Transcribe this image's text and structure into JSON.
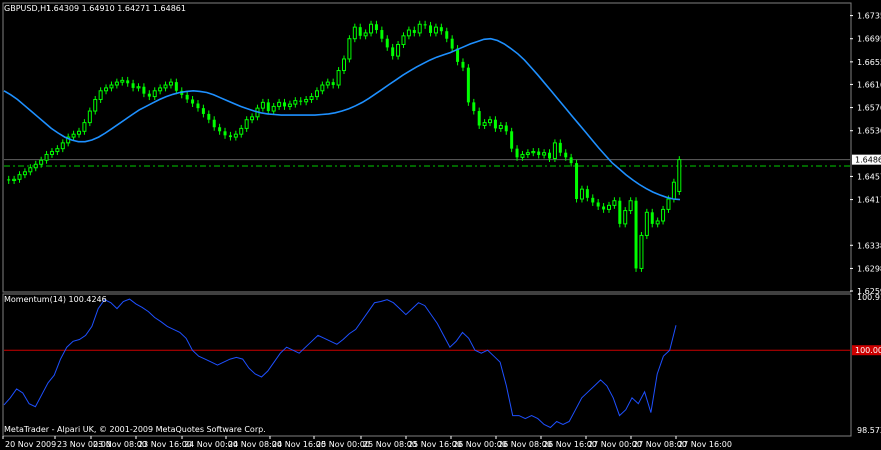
{
  "header": {
    "symbol": "GBPUSD,H1",
    "ohlc": "1.64309 1.64910 1.64271 1.64861"
  },
  "footer": {
    "copyright": "MetaTrader - Alpari UK, © 2001-2009 MetaQuotes Software Corp."
  },
  "colors": {
    "background": "#000000",
    "candle": "#00ff00",
    "ma_line": "#1e90ff",
    "level_line": "#00cc00",
    "momentum_line": "#1e50ff",
    "momentum_base": "#cc0000",
    "axis": "#ffffff",
    "base_badge": "#cc0000"
  },
  "chart_data": [
    {
      "type": "candlestick",
      "title": "GBPUSD,H1",
      "ylim": [
        1.6259,
        1.6755
      ],
      "y_ticks": [
        "1.67350",
        "1.66950",
        "1.66550",
        "1.66160",
        "1.65760",
        "1.65360",
        "1.64570",
        "1.64170",
        "1.63380",
        "1.62980",
        "1.62590"
      ],
      "last_price_label": "1.64861",
      "horizontal_level": 1.6475,
      "series": [
        {
          "name": "close",
          "values": [
            1.645,
            1.6452,
            1.646,
            1.6465,
            1.6472,
            1.6478,
            1.6485,
            1.6495,
            1.65,
            1.6505,
            1.6515,
            1.6525,
            1.653,
            1.6535,
            1.655,
            1.657,
            1.659,
            1.6605,
            1.661,
            1.6615,
            1.662,
            1.6623,
            1.6618,
            1.661,
            1.6612,
            1.66,
            1.6595,
            1.6605,
            1.661,
            1.6615,
            1.662,
            1.6605,
            1.6598,
            1.659,
            1.6583,
            1.6575,
            1.6565,
            1.6555,
            1.6542,
            1.6535,
            1.6528,
            1.6525,
            1.653,
            1.654,
            1.6555,
            1.656,
            1.6575,
            1.6585,
            1.657,
            1.6578,
            1.6585,
            1.6578,
            1.6582,
            1.6588,
            1.6586,
            1.659,
            1.6595,
            1.6605,
            1.6615,
            1.662,
            1.6615,
            1.664,
            1.666,
            1.6695,
            1.6715,
            1.67,
            1.6705,
            1.672,
            1.671,
            1.6695,
            1.668,
            1.6665,
            1.6685,
            1.67,
            1.671,
            1.6705,
            1.672,
            1.6718,
            1.6705,
            1.6715,
            1.6708,
            1.6695,
            1.6678,
            1.6655,
            1.6645,
            1.6585,
            1.657,
            1.6545,
            1.655,
            1.6555,
            1.654,
            1.6545,
            1.6535,
            1.6505,
            1.649,
            1.6495,
            1.6498,
            1.65,
            1.6494,
            1.6498,
            1.6488,
            1.6515,
            1.6498,
            1.649,
            1.648,
            1.6418,
            1.6435,
            1.642,
            1.6412,
            1.6405,
            1.64,
            1.6407,
            1.6415,
            1.6375,
            1.6398,
            1.6415,
            1.6298,
            1.6355,
            1.6395,
            1.6375,
            1.638,
            1.64,
            1.6418,
            1.6447,
            1.6486
          ],
          "open": [
            1.6452,
            1.645,
            1.6452,
            1.646,
            1.6465,
            1.6472,
            1.6478,
            1.6485,
            1.6495,
            1.65,
            1.6505,
            1.6515,
            1.6525,
            1.653,
            1.6535,
            1.655,
            1.657,
            1.659,
            1.6605,
            1.661,
            1.6615,
            1.662,
            1.6623,
            1.6618,
            1.661,
            1.6612,
            1.66,
            1.6595,
            1.6605,
            1.661,
            1.6615,
            1.662,
            1.6605,
            1.6598,
            1.659,
            1.6583,
            1.6575,
            1.6565,
            1.6555,
            1.6542,
            1.6535,
            1.6528,
            1.6525,
            1.653,
            1.654,
            1.6555,
            1.656,
            1.6575,
            1.6585,
            1.657,
            1.6578,
            1.6585,
            1.6578,
            1.6582,
            1.6588,
            1.6586,
            1.659,
            1.6595,
            1.6605,
            1.6615,
            1.662,
            1.6615,
            1.664,
            1.666,
            1.6695,
            1.6715,
            1.67,
            1.6705,
            1.672,
            1.671,
            1.6695,
            1.668,
            1.6665,
            1.6685,
            1.67,
            1.671,
            1.6705,
            1.672,
            1.6718,
            1.6705,
            1.6715,
            1.6708,
            1.6695,
            1.6678,
            1.6655,
            1.6645,
            1.6585,
            1.657,
            1.6545,
            1.655,
            1.6555,
            1.654,
            1.6545,
            1.6535,
            1.6505,
            1.649,
            1.6495,
            1.6498,
            1.65,
            1.6494,
            1.6498,
            1.6488,
            1.6515,
            1.6498,
            1.649,
            1.648,
            1.6418,
            1.6435,
            1.642,
            1.6412,
            1.6405,
            1.64,
            1.6407,
            1.6415,
            1.6375,
            1.6398,
            1.6415,
            1.6298,
            1.6355,
            1.6395,
            1.6375,
            1.638,
            1.64,
            1.6418,
            1.6431
          ]
        },
        {
          "name": "moving-average",
          "values": [
            1.6605,
            1.6598,
            1.659,
            1.658,
            1.657,
            1.656,
            1.655,
            1.654,
            1.6532,
            1.6525,
            1.652,
            1.6517,
            1.6517,
            1.652,
            1.6525,
            1.6532,
            1.654,
            1.6548,
            1.6556,
            1.6564,
            1.6572,
            1.6578,
            1.6584,
            1.659,
            1.6595,
            1.6599,
            1.6602,
            1.6604,
            1.6605,
            1.6604,
            1.6602,
            1.6598,
            1.6593,
            1.6588,
            1.6583,
            1.6578,
            1.6574,
            1.657,
            1.6567,
            1.6565,
            1.6564,
            1.6563,
            1.6563,
            1.6563,
            1.6563,
            1.6563,
            1.6563,
            1.6564,
            1.6565,
            1.6567,
            1.657,
            1.6574,
            1.6579,
            1.6585,
            1.6592,
            1.66,
            1.6608,
            1.6616,
            1.6624,
            1.6632,
            1.6639,
            1.6646,
            1.6652,
            1.6658,
            1.6663,
            1.6667,
            1.6671,
            1.6676,
            1.6681,
            1.6686,
            1.669,
            1.6694,
            1.6695,
            1.6692,
            1.6686,
            1.6678,
            1.6669,
            1.6658,
            1.6645,
            1.6632,
            1.6618,
            1.6604,
            1.659,
            1.6576,
            1.6562,
            1.6548,
            1.6534,
            1.652,
            1.6506,
            1.6493,
            1.648,
            1.647,
            1.646,
            1.6451,
            1.6443,
            1.6436,
            1.643,
            1.6425,
            1.6421,
            1.6418,
            1.6417
          ]
        }
      ]
    },
    {
      "type": "line",
      "title": "Momentum(14) 100.4246",
      "ylim": [
        98.5737,
        100.9122
      ],
      "y_ticks": [
        "100.912",
        "98.5737"
      ],
      "base_level": 100,
      "base_label": "100.000",
      "x_tick_labels": [
        "20 Nov 2009",
        "23 Nov 00:00",
        "23 Nov 08:00",
        "23 Nov 16:00",
        "24 Nov 00:00",
        "24 Nov 08:00",
        "24 Nov 16:00",
        "25 Nov 00:00",
        "25 Nov 08:00",
        "25 Nov 16:00",
        "26 Nov 00:00",
        "26 Nov 08:00",
        "26 Nov 16:00",
        "27 Nov 00:00",
        "27 Nov 08:00",
        "27 Nov 16:00"
      ],
      "series": [
        {
          "name": "Momentum(14)",
          "values": [
            99.08,
            99.2,
            99.35,
            99.28,
            99.1,
            99.05,
            99.25,
            99.45,
            99.58,
            99.85,
            100.05,
            100.15,
            100.18,
            100.25,
            100.4,
            100.7,
            100.85,
            100.8,
            100.7,
            100.82,
            100.86,
            100.78,
            100.72,
            100.65,
            100.55,
            100.48,
            100.4,
            100.35,
            100.3,
            100.2,
            100.0,
            99.9,
            99.85,
            99.8,
            99.75,
            99.8,
            99.85,
            99.88,
            99.85,
            99.7,
            99.6,
            99.55,
            99.65,
            99.8,
            99.95,
            100.05,
            100.0,
            99.95,
            100.05,
            100.15,
            100.25,
            100.2,
            100.15,
            100.1,
            100.18,
            100.28,
            100.35,
            100.5,
            100.65,
            100.8,
            100.82,
            100.85,
            100.8,
            100.7,
            100.6,
            100.7,
            100.8,
            100.75,
            100.6,
            100.45,
            100.25,
            100.05,
            100.15,
            100.3,
            100.2,
            100.0,
            99.95,
            100.0,
            99.9,
            99.8,
            99.4,
            98.9,
            98.9,
            98.85,
            98.9,
            98.85,
            98.75,
            98.7,
            98.8,
            98.75,
            98.8,
            99.0,
            99.2,
            99.3,
            99.4,
            99.5,
            99.4,
            99.2,
            98.9,
            99.0,
            99.2,
            99.1,
            99.3,
            98.95,
            99.6,
            99.9,
            100.0,
            100.42
          ]
        }
      ]
    }
  ]
}
